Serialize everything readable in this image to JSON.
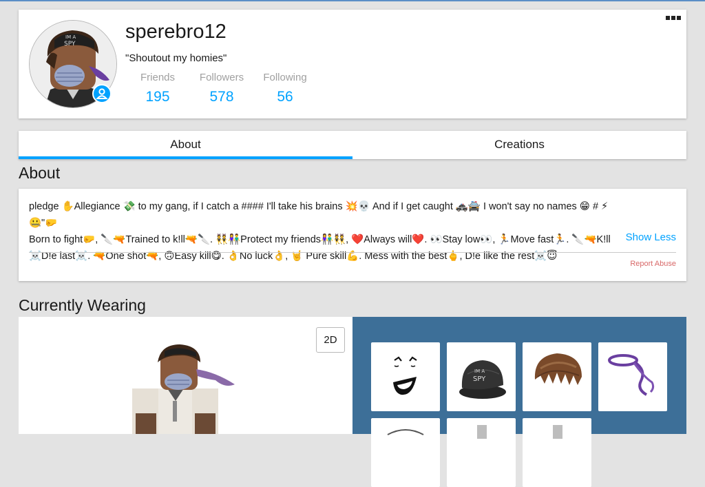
{
  "profile": {
    "username": "sperebro12",
    "status": "\"Shoutout my homies\"",
    "stats": {
      "friends_label": "Friends",
      "friends_value": "195",
      "followers_label": "Followers",
      "followers_value": "578",
      "following_label": "Following",
      "following_value": "56"
    }
  },
  "tabs": {
    "about": "About",
    "creations": "Creations"
  },
  "about": {
    "title": "About",
    "lines": [
      "pledge ✋Allegiance 💸 to my gang, if I catch a #### I'll take his brains 💥💀 And if I get caught 🚓🚔 I won't say no names 😁 # ⚡🤐\"🤛",
      "Born to fight🤛, 🔪🔫Trained to k!ll🔫🔪. 👯👫Protect my friends👫👯, ❤️Always will❤️. 👀Stay low👀, 🏃Move fast🏃. 🔪🔫K!ll",
      "☠️D!e last☠️. 🔫One shot🔫, 🙃Easy kill😋. 👌No luck👌, 🤘 Pure skill💪. Mess with the best🖕, D!e like the rest☠️😇"
    ],
    "show_less": "Show Less",
    "report_abuse": "Report Abuse"
  },
  "wearing": {
    "title": "Currently Wearing",
    "toggle_2d": "2D"
  },
  "colors": {
    "accent": "#00a2ff",
    "report": "#d86868",
    "items_panel": "#3d6f98"
  },
  "icons": {
    "online_badge": "user-icon",
    "more_menu": "more-dots-icon"
  }
}
